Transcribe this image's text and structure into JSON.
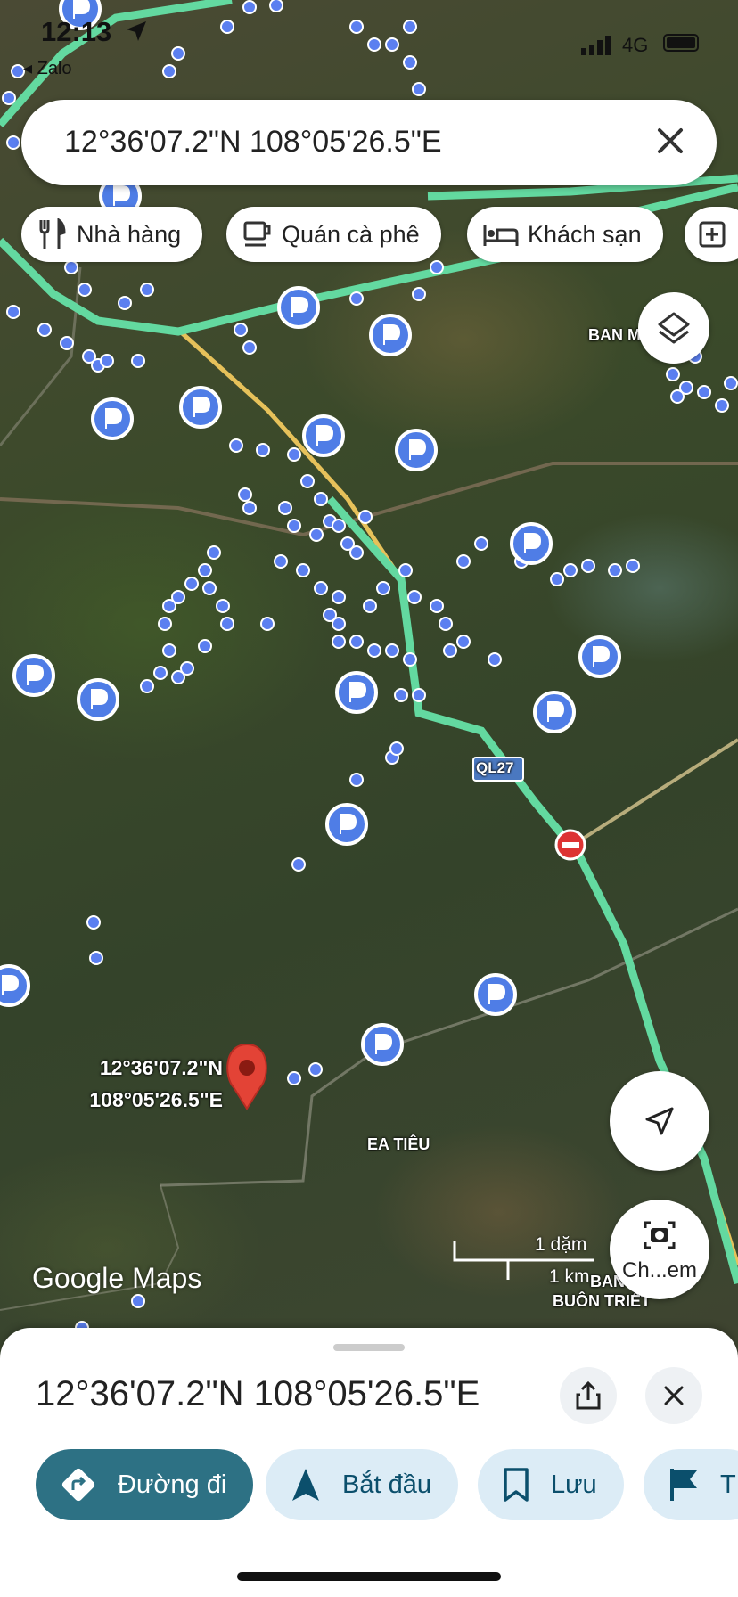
{
  "status_bar": {
    "time": "12:13",
    "back_app": "◂ Zalo",
    "network": "4G"
  },
  "search": {
    "query": "12°36'07.2\"N 108°05'26.5\"E"
  },
  "chips": [
    {
      "label": "Nhà hàng",
      "icon": "fork-knife-icon"
    },
    {
      "label": "Quán cà phê",
      "icon": "coffee-cup-icon"
    },
    {
      "label": "Khách sạn",
      "icon": "bed-icon"
    },
    {
      "label": "",
      "icon": "add-box-icon"
    }
  ],
  "map": {
    "labels": {
      "ban_me": "BAN M",
      "ql27": "QL27",
      "ea_tieu": "EA TIÊU",
      "buon_triet": "BUÔN TRIẾT",
      "ban_partial": "BAN"
    },
    "pin_label_line1": "12°36'07.2\"N",
    "pin_label_line2": "108°05'26.5\"E",
    "brand": "Google Maps",
    "scale_top": "1 dặm",
    "scale_bottom": "1 km",
    "lens_label": "Ch...em",
    "colors": {
      "route": "#63d9a0",
      "parking": "#4f7de6",
      "pin": "#e34336"
    }
  },
  "sheet": {
    "title": "12°36'07.2\"N 108°05'26.5\"E",
    "actions": [
      {
        "label": "Đường đi",
        "icon": "directions-icon"
      },
      {
        "label": "Bắt đầu",
        "icon": "navigation-arrow-icon"
      },
      {
        "label": "Lưu",
        "icon": "bookmark-icon"
      },
      {
        "label": "T",
        "icon": "flag-icon"
      }
    ]
  }
}
